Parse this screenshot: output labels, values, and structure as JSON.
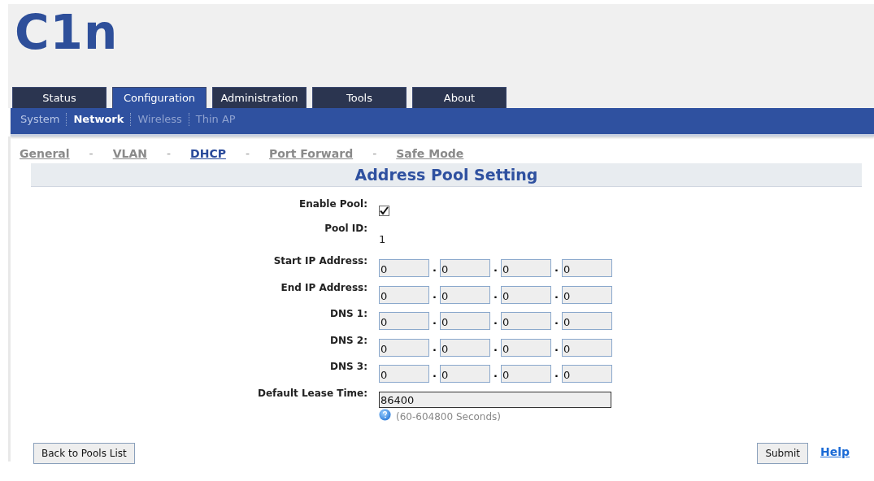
{
  "logo": "C1n",
  "tabs": [
    {
      "label": "Status",
      "selected": false
    },
    {
      "label": "Configuration",
      "selected": true
    },
    {
      "label": "Administration",
      "selected": false
    },
    {
      "label": "Tools",
      "selected": false
    },
    {
      "label": "About",
      "selected": false
    }
  ],
  "subnav": [
    {
      "label": "System",
      "selected": false,
      "disabled": false
    },
    {
      "label": "Network",
      "selected": true,
      "disabled": false
    },
    {
      "label": "Wireless",
      "selected": false,
      "disabled": true
    },
    {
      "label": "Thin AP",
      "selected": false,
      "disabled": true
    }
  ],
  "section_links": [
    {
      "label": "General",
      "selected": false
    },
    {
      "separator": "-",
      "label": "VLAN",
      "selected": false
    },
    {
      "separator": "-",
      "label": "DHCP",
      "selected": true
    },
    {
      "separator": "-",
      "label": "Port Forward",
      "selected": false
    },
    {
      "separator": "-",
      "label": "Safe Mode",
      "selected": false
    }
  ],
  "title": "Address Pool Setting",
  "form": [
    {
      "kind": "checkbox",
      "label": "Enable Pool:",
      "checked": true
    },
    {
      "kind": "text",
      "label": "Pool ID:",
      "value": "1"
    },
    {
      "kind": "ip",
      "label": "Start IP Address:",
      "octets": [
        "0",
        "0",
        "0",
        "0"
      ],
      "dots": [
        ".",
        ".",
        "."
      ]
    },
    {
      "kind": "ip",
      "label": "End IP Address:",
      "octets": [
        "0",
        "0",
        "0",
        "0"
      ],
      "dots": [
        ".",
        ".",
        "."
      ]
    },
    {
      "kind": "ip",
      "label": "DNS 1:",
      "octets": [
        "0",
        "0",
        "0",
        "0"
      ],
      "dots": [
        ".",
        ".",
        "."
      ]
    },
    {
      "kind": "ip",
      "label": "DNS 2:",
      "octets": [
        "0",
        "0",
        "0",
        "0"
      ],
      "dots": [
        ".",
        ".",
        "."
      ]
    },
    {
      "kind": "ip",
      "label": "DNS 3:",
      "octets": [
        "0",
        "0",
        "0",
        "0"
      ],
      "dots": [
        ".",
        ".",
        "."
      ]
    },
    {
      "kind": "input",
      "label": "Default Lease Time:",
      "value": "86400",
      "hint": "(60-604800 Seconds)"
    }
  ],
  "buttons": {
    "back": "Back to Pools List",
    "submit": "Submit",
    "help": "Help"
  }
}
